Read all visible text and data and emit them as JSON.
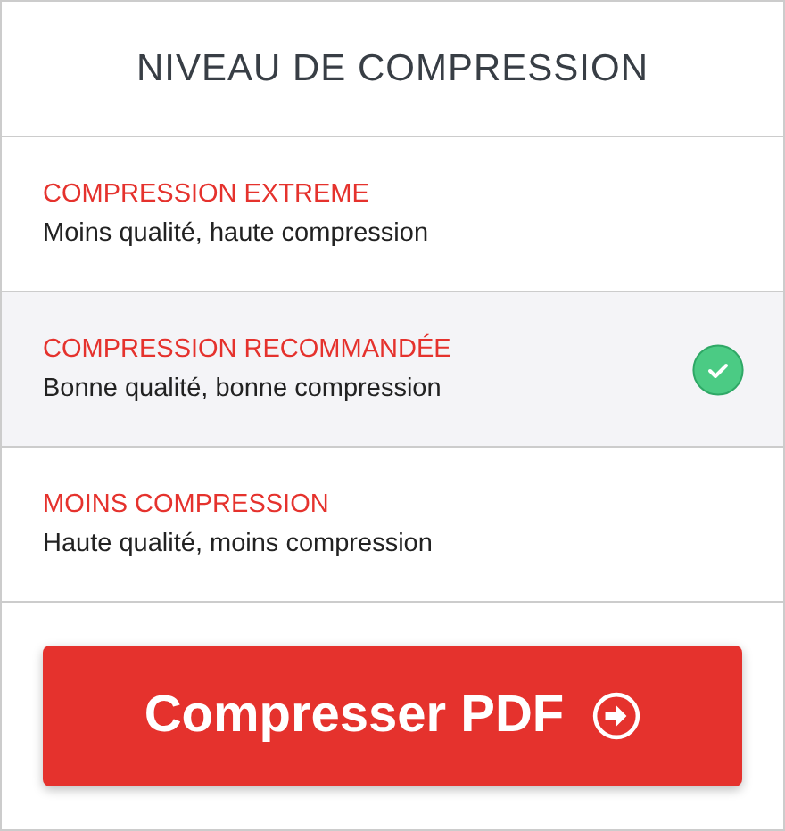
{
  "title": "NIVEAU DE COMPRESSION",
  "options": [
    {
      "title": "COMPRESSION EXTREME",
      "description": "Moins qualité, haute compression",
      "selected": false
    },
    {
      "title": "COMPRESSION RECOMMANDÉE",
      "description": "Bonne qualité, bonne compression",
      "selected": true
    },
    {
      "title": "MOINS COMPRESSION",
      "description": "Haute qualité, moins compression",
      "selected": false
    }
  ],
  "button": {
    "label": "Compresser PDF"
  }
}
